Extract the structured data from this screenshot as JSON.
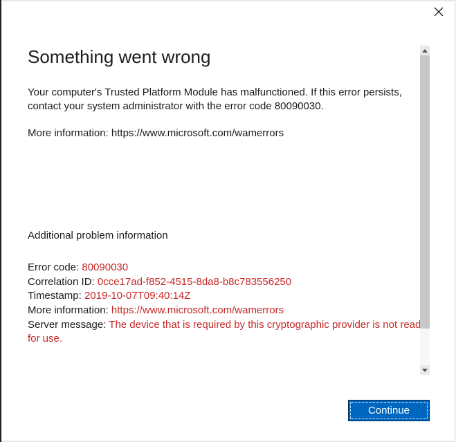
{
  "dialog": {
    "title": "Something went wrong",
    "message": "Your computer's Trusted Platform Module has malfunctioned. If this error persists, contact your system administrator with the error code 80090030.",
    "more_info_prefix": "More information: ",
    "more_info_url": "https://www.microsoft.com/wamerrors",
    "additional_heading": "Additional problem information",
    "details": {
      "error_code_label": "Error code: ",
      "error_code_value": "80090030",
      "correlation_label": "Correlation ID: ",
      "correlation_value": "0cce17ad-f852-4515-8da8-b8c783556250",
      "timestamp_label": "Timestamp: ",
      "timestamp_value": "2019-10-07T09:40:14Z",
      "more_info_label": "More information: ",
      "more_info_value": "https://www.microsoft.com/wamerrors",
      "server_message_label": "Server message: ",
      "server_message_value": "The device that is required by this cryptographic provider is not ready for use."
    },
    "continue_label": "Continue"
  }
}
